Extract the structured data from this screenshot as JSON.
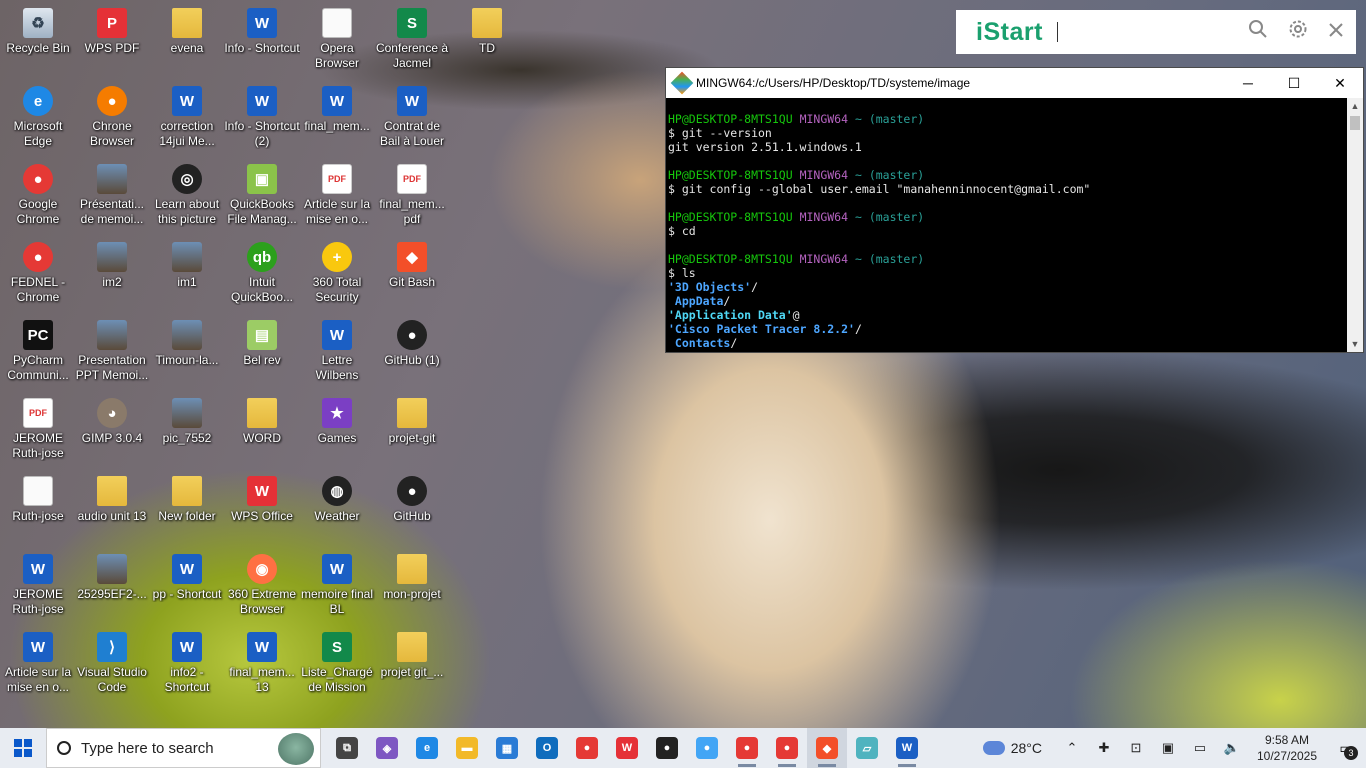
{
  "desktop_icons": [
    {
      "label": "Recycle Bin",
      "icon": "recycle-bin-icon",
      "type": "bin",
      "glyph": "♻"
    },
    {
      "label": "Microsoft Edge",
      "icon": "edge-icon",
      "type": "round",
      "glyph": "e",
      "color": "#1e88e5"
    },
    {
      "label": "Google Chrome",
      "icon": "chrome-icon",
      "type": "round",
      "glyph": "●",
      "color": "#e53935"
    },
    {
      "label": "FEDNEL - Chrome",
      "icon": "chrome-profile-icon",
      "type": "round",
      "glyph": "●",
      "color": "#e53935"
    },
    {
      "label": "PyCharm Communi...",
      "icon": "pycharm-icon",
      "type": "dark-square",
      "glyph": "PC",
      "color": "#111"
    },
    {
      "label": "JEROME Ruth-jose",
      "icon": "pdf-icon",
      "type": "pdf",
      "glyph": "PDF"
    },
    {
      "label": "Ruth-jose",
      "icon": "text-file-icon",
      "type": "file",
      "glyph": ""
    },
    {
      "label": "JEROME Ruth-jose",
      "icon": "word-doc-icon",
      "type": "word",
      "glyph": "W"
    },
    {
      "label": "Article sur la mise en o...",
      "icon": "word-doc-icon",
      "type": "word",
      "glyph": "W"
    },
    {
      "label": "WPS PDF",
      "icon": "wps-pdf-icon",
      "type": "wps",
      "glyph": "P"
    },
    {
      "label": "Chrone Browser",
      "icon": "chrone-browser-icon",
      "type": "round",
      "glyph": "●",
      "color": "#f57c00"
    },
    {
      "label": "Présentati... de memoi...",
      "icon": "image-file-icon",
      "type": "photo",
      "glyph": ""
    },
    {
      "label": "im2",
      "icon": "image-file-icon",
      "type": "photo",
      "glyph": ""
    },
    {
      "label": "Presentation PPT Memoi...",
      "icon": "image-file-icon",
      "type": "photo",
      "glyph": ""
    },
    {
      "label": "GIMP 3.0.4",
      "icon": "gimp-icon",
      "type": "round",
      "glyph": "◕",
      "color": "#8a7a6a"
    },
    {
      "label": "audio unit 13",
      "icon": "folder-zip-icon",
      "type": "folder",
      "glyph": ""
    },
    {
      "label": "25295EF2-...",
      "icon": "image-file-icon",
      "type": "photo",
      "glyph": ""
    },
    {
      "label": "Visual Studio Code",
      "icon": "vscode-icon",
      "type": "square",
      "glyph": "⟩",
      "color": "#1f7fd1"
    },
    {
      "label": "evena",
      "icon": "folder-zip-icon",
      "type": "folder",
      "glyph": ""
    },
    {
      "label": "correction 14jui Me...",
      "icon": "word-doc-icon",
      "type": "word",
      "glyph": "W"
    },
    {
      "label": "Learn about this picture",
      "icon": "camera-icon",
      "type": "dark",
      "glyph": "◎"
    },
    {
      "label": "im1",
      "icon": "image-file-icon",
      "type": "photo",
      "glyph": ""
    },
    {
      "label": "Timoun-la...",
      "icon": "image-file-icon",
      "type": "photo",
      "glyph": ""
    },
    {
      "label": "pic_7552",
      "icon": "image-file-icon",
      "type": "photo",
      "glyph": ""
    },
    {
      "label": "New folder",
      "icon": "folder-icon",
      "type": "folder",
      "glyph": ""
    },
    {
      "label": "pp - Shortcut",
      "icon": "word-doc-icon",
      "type": "word",
      "glyph": "W"
    },
    {
      "label": "info2 - Shortcut",
      "icon": "word-doc-icon",
      "type": "word",
      "glyph": "W"
    },
    {
      "label": "Info - Shortcut",
      "icon": "word-doc-icon",
      "type": "word",
      "glyph": "W"
    },
    {
      "label": "Info - Shortcut (2)",
      "icon": "word-doc-icon",
      "type": "word",
      "glyph": "W"
    },
    {
      "label": "QuickBooks File Manag...",
      "icon": "quickbooks-file-icon",
      "type": "square",
      "glyph": "▣",
      "color": "#8bc34a"
    },
    {
      "label": "Intuit QuickBoo...",
      "icon": "quickbooks-icon",
      "type": "round",
      "glyph": "qb",
      "color": "#2ca01c"
    },
    {
      "label": "Bel rev",
      "icon": "archive-icon",
      "type": "square",
      "glyph": "▤",
      "color": "#9ccc65"
    },
    {
      "label": "WORD",
      "icon": "folder-icon",
      "type": "folder",
      "glyph": ""
    },
    {
      "label": "WPS Office",
      "icon": "wps-office-icon",
      "type": "wps",
      "glyph": "W"
    },
    {
      "label": "360 Extreme Browser",
      "icon": "360-browser-icon",
      "type": "round",
      "glyph": "◉",
      "color": "#ff7043"
    },
    {
      "label": "final_mem... 13",
      "icon": "word-doc-icon",
      "type": "word",
      "glyph": "W"
    },
    {
      "label": "Opera Browser",
      "icon": "file-icon",
      "type": "file",
      "glyph": ""
    },
    {
      "label": "final_mem...",
      "icon": "word-doc-icon",
      "type": "word",
      "glyph": "W"
    },
    {
      "label": "Article sur la mise en o...",
      "icon": "pdf-icon",
      "type": "pdf",
      "glyph": "PDF"
    },
    {
      "label": "360 Total Security",
      "icon": "360-security-icon",
      "type": "round",
      "glyph": "+",
      "color": "#f9c80e"
    },
    {
      "label": "Lettre Wilbens",
      "icon": "word-doc-icon",
      "type": "word",
      "glyph": "W"
    },
    {
      "label": "Games",
      "icon": "games-icon",
      "type": "square",
      "glyph": "★",
      "color": "#7b3fc4"
    },
    {
      "label": "Weather",
      "icon": "weather-icon",
      "type": "dark",
      "glyph": "◍"
    },
    {
      "label": "memoire final BL",
      "icon": "word-doc-icon",
      "type": "word",
      "glyph": "W"
    },
    {
      "label": "Liste_Chargé de Mission",
      "icon": "excel-icon",
      "type": "sheet",
      "glyph": "S"
    },
    {
      "label": "Conference à Jacmel",
      "icon": "excel-icon",
      "type": "sheet",
      "glyph": "S"
    },
    {
      "label": "Contrat de Bail à Louer",
      "icon": "word-doc-icon",
      "type": "word",
      "glyph": "W"
    },
    {
      "label": "final_mem... pdf",
      "icon": "pdf-icon",
      "type": "pdf",
      "glyph": "PDF"
    },
    {
      "label": "Git Bash",
      "icon": "git-bash-icon",
      "type": "square",
      "glyph": "◆",
      "color": "#f34f29"
    },
    {
      "label": "GitHub (1)",
      "icon": "github-icon",
      "type": "dark",
      "glyph": "●"
    },
    {
      "label": "projet-git",
      "icon": "folder-zip-icon",
      "type": "folder",
      "glyph": ""
    },
    {
      "label": "GitHub",
      "icon": "github-icon",
      "type": "dark",
      "glyph": "●"
    },
    {
      "label": "mon-projet",
      "icon": "folder-icon",
      "type": "folder",
      "glyph": ""
    },
    {
      "label": "projet git_...",
      "icon": "folder-zip-icon",
      "type": "folder",
      "glyph": ""
    },
    {
      "label": "TD",
      "icon": "folder-zip-icon",
      "type": "folder",
      "glyph": ""
    }
  ],
  "istart": {
    "logo": "iStart",
    "placeholder": "",
    "search_icon": "search-icon",
    "settings_icon": "gear-icon",
    "close_icon": "close-icon"
  },
  "terminal": {
    "title": "MINGW64:/c/Users/HP/Desktop/TD/systeme/image",
    "minimize": "─",
    "maximize": "☐",
    "close": "✕",
    "lines": [
      [
        {
          "t": "HP@DESKTOP-8MTS1QU ",
          "c": "green"
        },
        {
          "t": "MINGW64 ",
          "c": "purple"
        },
        {
          "t": "~ ",
          "c": "teal"
        },
        {
          "t": "(master)",
          "c": "teal"
        }
      ],
      [
        {
          "t": "$ git --version",
          "c": "white"
        }
      ],
      [
        {
          "t": "git version 2.51.1.windows.1",
          "c": "white"
        }
      ],
      [
        {
          "t": "",
          "c": "white"
        }
      ],
      [
        {
          "t": "HP@DESKTOP-8MTS1QU ",
          "c": "green"
        },
        {
          "t": "MINGW64 ",
          "c": "purple"
        },
        {
          "t": "~ ",
          "c": "teal"
        },
        {
          "t": "(master)",
          "c": "teal"
        }
      ],
      [
        {
          "t": "$ git config --global user.email \"manahenninnocent@gmail.com\"",
          "c": "white"
        }
      ],
      [
        {
          "t": "",
          "c": "white"
        }
      ],
      [
        {
          "t": "HP@DESKTOP-8MTS1QU ",
          "c": "green"
        },
        {
          "t": "MINGW64 ",
          "c": "purple"
        },
        {
          "t": "~ ",
          "c": "teal"
        },
        {
          "t": "(master)",
          "c": "teal"
        }
      ],
      [
        {
          "t": "$ cd",
          "c": "white"
        }
      ],
      [
        {
          "t": "",
          "c": "white"
        }
      ],
      [
        {
          "t": "HP@DESKTOP-8MTS1QU ",
          "c": "green"
        },
        {
          "t": "MINGW64 ",
          "c": "purple"
        },
        {
          "t": "~ ",
          "c": "teal"
        },
        {
          "t": "(master)",
          "c": "teal"
        }
      ],
      [
        {
          "t": "$ ls",
          "c": "white"
        }
      ],
      [
        {
          "t": "'3D Objects'",
          "c": "blue"
        },
        {
          "t": "/",
          "c": "white"
        }
      ],
      [
        {
          "t": " AppData",
          "c": "blue"
        },
        {
          "t": "/",
          "c": "white"
        }
      ],
      [
        {
          "t": "'Application Data'",
          "c": "cyan"
        },
        {
          "t": "@",
          "c": "white"
        }
      ],
      [
        {
          "t": "'Cisco Packet Tracer 8.2.2'",
          "c": "blue"
        },
        {
          "t": "/",
          "c": "white"
        }
      ],
      [
        {
          "t": " Contacts",
          "c": "blue"
        },
        {
          "t": "/",
          "c": "white"
        }
      ]
    ]
  },
  "taskbar": {
    "search_placeholder": "Type here to search",
    "apps": [
      {
        "icon": "task-view-icon",
        "glyph": "⧉",
        "color": "#444",
        "open": false
      },
      {
        "icon": "copilot-icon",
        "glyph": "◈",
        "color": "#7e57c2",
        "open": false
      },
      {
        "icon": "edge-icon",
        "glyph": "e",
        "color": "#1e88e5",
        "open": false
      },
      {
        "icon": "file-explorer-icon",
        "glyph": "▬",
        "color": "#f2b929",
        "open": false
      },
      {
        "icon": "microsoft-store-icon",
        "glyph": "▦",
        "color": "#2a7bd5",
        "open": false
      },
      {
        "icon": "outlook-icon",
        "glyph": "O",
        "color": "#0f6cbd",
        "open": false
      },
      {
        "icon": "chrome-icon",
        "glyph": "●",
        "color": "#e53935",
        "open": false
      },
      {
        "icon": "wps-office-icon",
        "glyph": "W",
        "color": "#e53137",
        "open": false
      },
      {
        "icon": "github-icon",
        "glyph": "●",
        "color": "#222",
        "open": false
      },
      {
        "icon": "chrone-browser-icon",
        "glyph": "●",
        "color": "#42a5f5",
        "open": false
      },
      {
        "icon": "chrome-profile-icon",
        "glyph": "●",
        "color": "#e53935",
        "open": true
      },
      {
        "icon": "chrome-profile-2-icon",
        "glyph": "●",
        "color": "#e53935",
        "open": true
      },
      {
        "icon": "git-bash-icon",
        "glyph": "◆",
        "color": "#f34f29",
        "open": true,
        "active": true
      },
      {
        "icon": "notepad-icon",
        "glyph": "▱",
        "color": "#4fb3bf",
        "open": false
      },
      {
        "icon": "word-icon",
        "glyph": "W",
        "color": "#1b5fc4",
        "open": true
      }
    ],
    "weather": {
      "temp": "28°C",
      "icon": "weather-cloud-icon"
    },
    "tray_icons": [
      {
        "icon": "chevron-up-icon",
        "glyph": "⌃"
      },
      {
        "icon": "360-tray-icon",
        "glyph": "✚"
      },
      {
        "icon": "camera-tray-icon",
        "glyph": "⊡"
      },
      {
        "icon": "display-tray-icon",
        "glyph": "▣"
      },
      {
        "icon": "battery-icon",
        "glyph": "▭"
      },
      {
        "icon": "volume-icon",
        "glyph": "🔈"
      }
    ],
    "time": "9:58 AM",
    "date": "10/27/2025",
    "notification_count": "3"
  }
}
